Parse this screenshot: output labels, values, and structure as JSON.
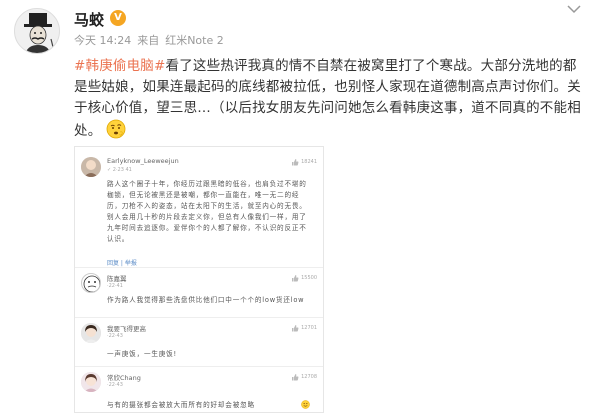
{
  "post": {
    "username": "马蛟",
    "vip_badge": "V",
    "time": "今天 14:24",
    "source_prefix": "来自",
    "source": "红米Note 2",
    "hashtag": "#韩庚偷电脑#",
    "text_part1": "看了这些热评我真的情不自禁在被窝里打了个寒战。大部分洗地的都是些姑娘，如果连最起码的底线都被拉低，也别怪人家现在道德制高点声讨你们。关于核心价值，望三思…（以后找女朋友先问问她怎么看韩庚这事，道不同真的不能相处。",
    "emoji_name": "doubt-emoji"
  },
  "comments": [
    {
      "name": "Earlyknow_Leeweejun",
      "time": "✓ 2·23 41",
      "likes": "18241",
      "body": "路人这个圈子十年，你经历过跟黑暗的低谷，也肩负过不堪的枷锁，但无论被黑还是被嘲，都你一直能在，唯一无二的经历，刀枪不入的姿态，站在太阳下的生活，就至内心的无畏。别人会用几十秒的片段去定义你，但总有人像我们一样，用了九年时间去追逐你。爱伴你个的人都了解你，不认识的反正不认识。",
      "reply": "回复 | 举报"
    },
    {
      "name": "陈嘉翼",
      "time": "·22·41",
      "likes": "15500",
      "body": "作为路人我觉得那些洗盘供比他们口中一个个的low货还low"
    },
    {
      "name": "我要飞得更高",
      "time": "·22·43",
      "likes": "12701",
      "body": "一声庚饭，一生庚饭!"
    },
    {
      "name": "常欣Chang",
      "time": "·22·43",
      "likes": "12708",
      "body": "与有的摄张都会被放大而所有的好却会被忽略"
    }
  ]
}
